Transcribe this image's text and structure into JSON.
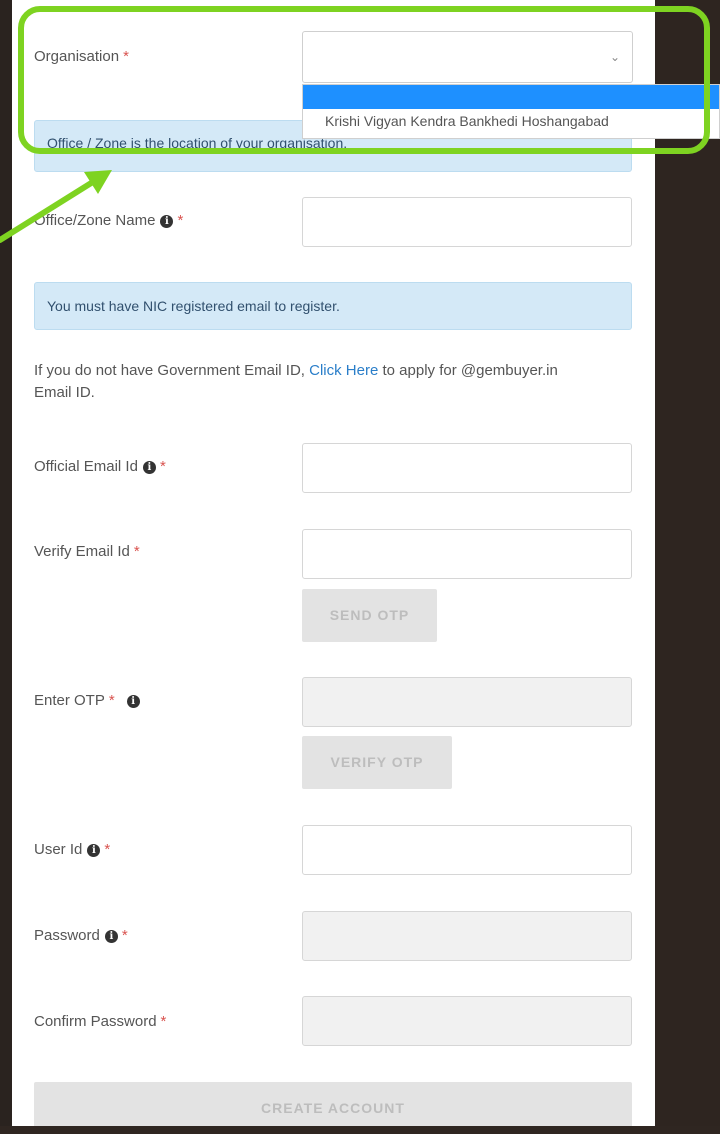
{
  "form": {
    "organisation": {
      "label": "Organisation",
      "required_mark": "*",
      "selected": ""
    },
    "dropdown": {
      "options": [
        "Krishi Vigyan Kendra Bankhedi Hoshangabad"
      ]
    },
    "office_alert": "Office / Zone is the location of your organisation.",
    "office_zone": {
      "label": "Office/Zone Name",
      "required_mark": "*",
      "info_icon": "i"
    },
    "nic_alert": "You must have NIC registered email to register.",
    "gov_email_note": {
      "before": "If you do not have Government Email ID, ",
      "link": "Click Here",
      "after": " to apply for @gembuyer.in Email ID."
    },
    "official_email": {
      "label": "Official Email Id",
      "required_mark": "*",
      "info_icon": "i"
    },
    "verify_email": {
      "label": "Verify Email Id",
      "required_mark": "*"
    },
    "send_otp_button": "SEND OTP",
    "enter_otp": {
      "label": "Enter OTP",
      "required_mark": "*",
      "info_icon": "i"
    },
    "verify_otp_button": "VERIFY OTP",
    "user_id": {
      "label": "User Id",
      "required_mark": "*",
      "info_icon": "i"
    },
    "password": {
      "label": "Password",
      "required_mark": "*",
      "info_icon": "i"
    },
    "confirm_password": {
      "label": "Confirm Password",
      "required_mark": "*"
    },
    "create_account_button": "CREATE ACCOUNT"
  },
  "icons": {
    "dropdown_chevron": "⌄"
  },
  "colors": {
    "highlight": "#7ed321",
    "dropdown_selected": "#1e90ff",
    "alert_bg": "#d4e9f7",
    "link": "#2a7ec9"
  }
}
